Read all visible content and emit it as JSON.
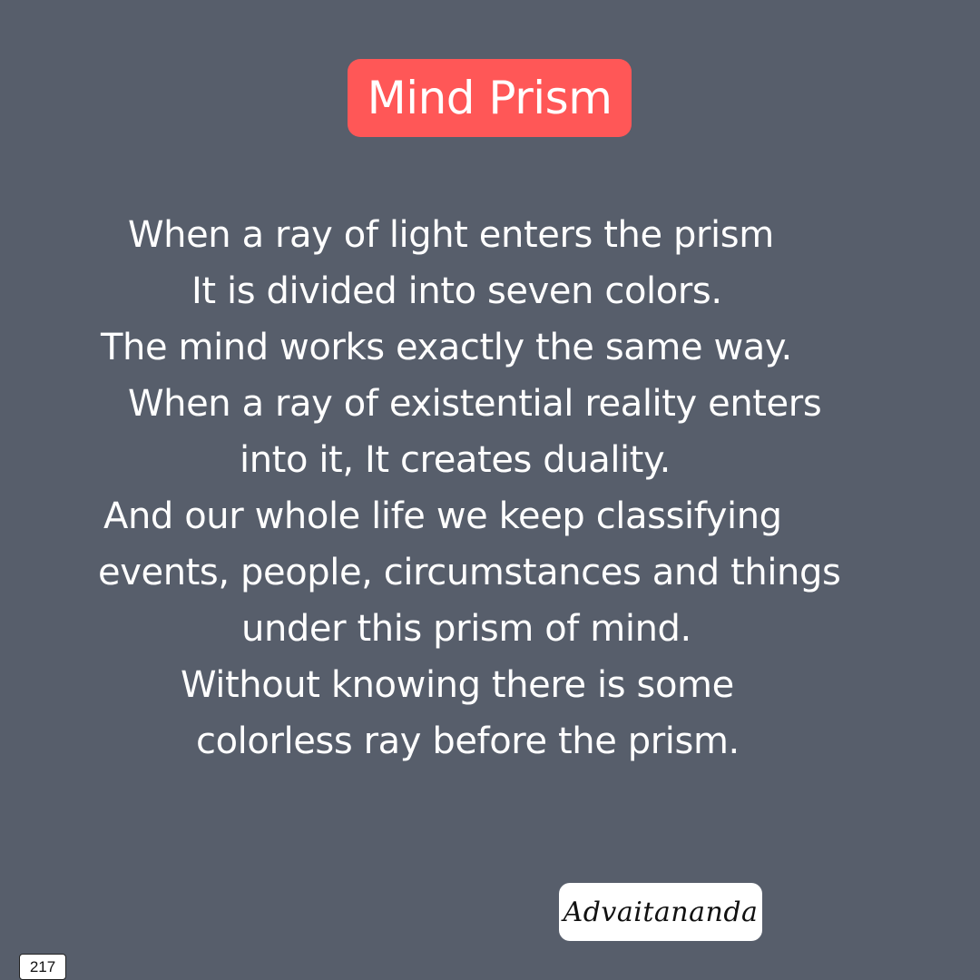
{
  "title": "Mind Prism",
  "poem_lines": [
    "When a ray of light enters the prism",
    "It is divided into seven colors.",
    "The mind works exactly the same way.",
    "When a ray of existential reality enters",
    "into it, It creates duality.",
    "And our whole life we keep classifying",
    "events, people, circumstances and things",
    "under this prism of mind.",
    "Without knowing there is some",
    "colorless ray before the prism."
  ],
  "signature": "Advaitananda",
  "page_number": "217",
  "colors": {
    "background": "#575e6b",
    "title_badge": "#ff5757",
    "text": "#ffffff",
    "signature_badge": "#ffffff"
  }
}
